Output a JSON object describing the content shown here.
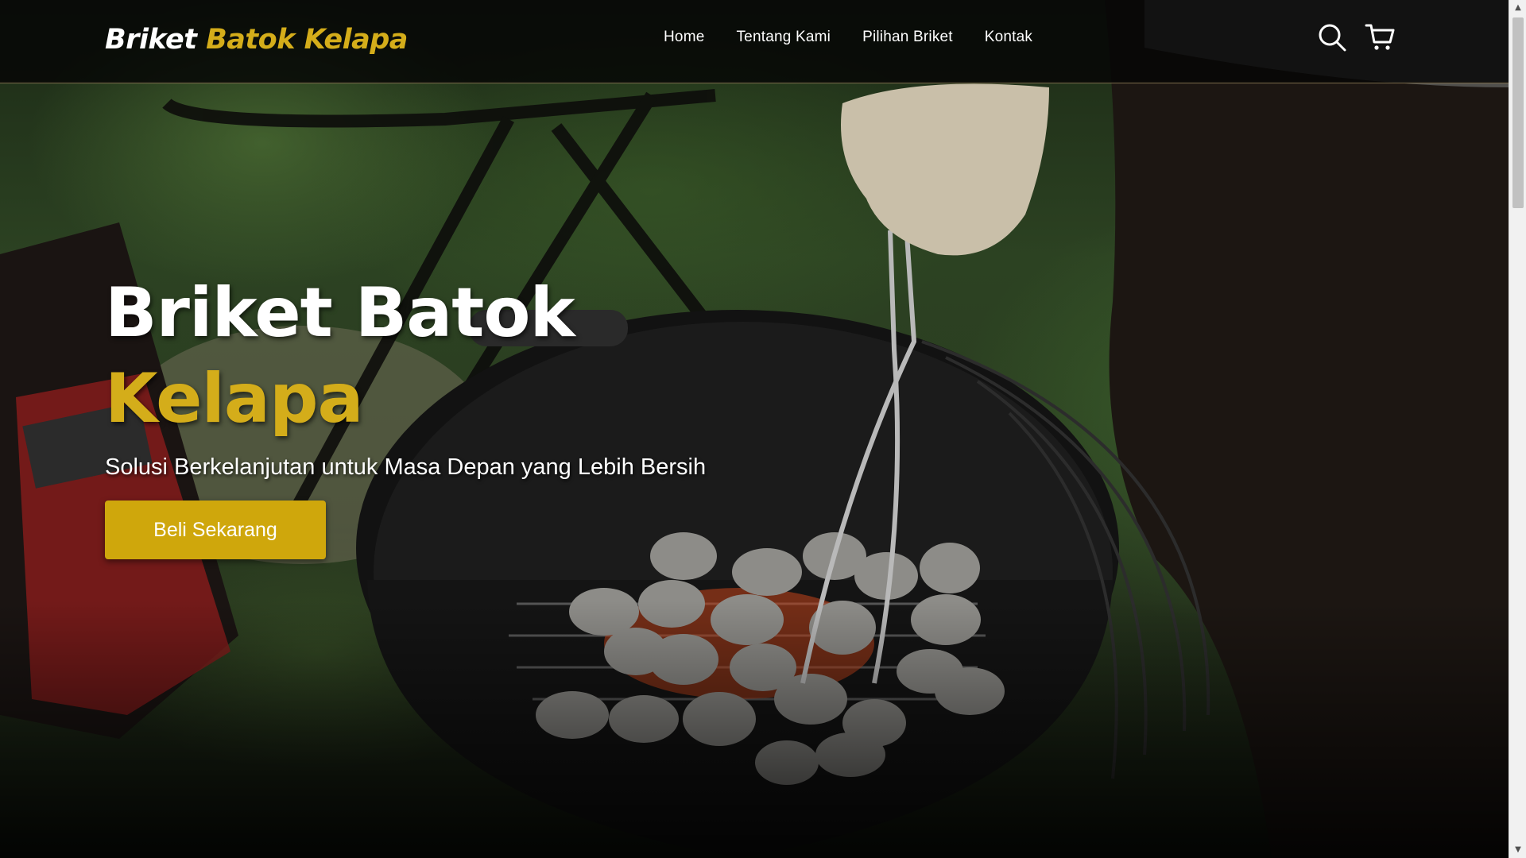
{
  "brand": {
    "part1": "Briket",
    "part2": "Batok Kelapa"
  },
  "nav": {
    "links": [
      {
        "label": "Home"
      },
      {
        "label": "Tentang Kami"
      },
      {
        "label": "Pilihan Briket"
      },
      {
        "label": "Kontak"
      }
    ],
    "icons": [
      "search-icon",
      "cart-icon"
    ]
  },
  "hero": {
    "title_line1": "Briket Batok",
    "title_line2": "Kelapa",
    "subtitle": "Solusi Berkelanjutan untuk Masa Depan yang Lebih Bersih",
    "cta_label": "Beli Sekarang"
  },
  "colors": {
    "accent": "#d4ad1a",
    "button": "#cfa70c",
    "navbar_bg": "#050505",
    "text": "#ffffff"
  }
}
